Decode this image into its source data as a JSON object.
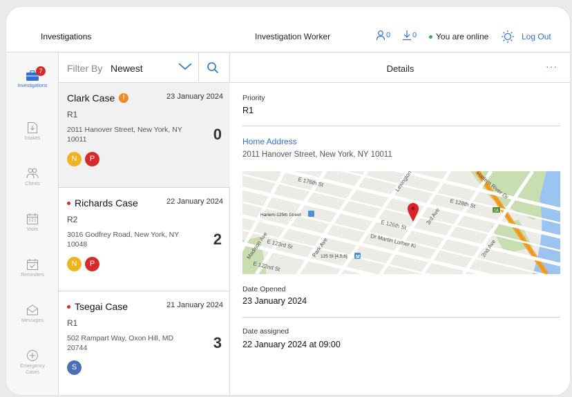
{
  "header": {
    "title": "Investigations",
    "role": "Investigation Worker",
    "clients_count": "0",
    "downloads_count": "0",
    "status_text": "You are online",
    "logout_label": "Log Out"
  },
  "sidebar": {
    "investigations_badge": "7",
    "items": [
      {
        "label": "Investigations",
        "icon": "briefcase-icon"
      },
      {
        "label": "Intakes",
        "icon": "intake-icon"
      },
      {
        "label": "Clients",
        "icon": "clients-icon"
      },
      {
        "label": "Visits",
        "icon": "calendar-icon"
      },
      {
        "label": "Reminders",
        "icon": "calendar-check-icon"
      },
      {
        "label": "Messages",
        "icon": "envelope-icon"
      },
      {
        "label": "Emergency Cases",
        "icon": "plus-circle-icon"
      }
    ]
  },
  "filter": {
    "label": "Filter By",
    "value": "Newest"
  },
  "cases": [
    {
      "name": "Clark Case",
      "date": "23 January 2024",
      "priority": "R1",
      "address": "2011 Hanover Street, New York, NY 10011",
      "count": "0",
      "avatars": [
        {
          "letter": "N",
          "color": "#f2b21e"
        },
        {
          "letter": "P",
          "color": "#d62b2b"
        }
      ]
    },
    {
      "name": "Richards Case",
      "date": "22 January 2024",
      "priority": "R2",
      "address": "3016 Godfrey Road, New York, NY 10048",
      "count": "2",
      "avatars": [
        {
          "letter": "N",
          "color": "#f2b21e"
        },
        {
          "letter": "P",
          "color": "#d62b2b"
        }
      ]
    },
    {
      "name": "Tsegai Case",
      "date": "21 January 2024",
      "priority": "R1",
      "address": "502 Rampart Way, Oxon Hill, MD 20744",
      "count": "3",
      "avatars": [
        {
          "letter": "S",
          "color": "#4a6fb5"
        }
      ]
    }
  ],
  "details": {
    "title": "Details",
    "more": "···",
    "priority_label": "Priority",
    "priority_value": "R1",
    "home_address_label": "Home Address",
    "home_address_value": "2011 Hanover Street, New York, NY 10011",
    "date_opened_label": "Date Opened",
    "date_opened_value": "23 January 2024",
    "date_assigned_label": "Date assigned",
    "date_assigned_value": "22 January 2024 at 09:00",
    "map_labels": {
      "st176": "E 176th St",
      "lexington": "Lexington",
      "harlem": "Harlem-125th Street",
      "st126": "E 126th St",
      "third_ave": "3rd Ave",
      "st128": "E 128th St",
      "madison": "Madison Ave",
      "park": "Park Ave",
      "station": "125 St [4,5,6]",
      "mlk": "Dr Martin Luther Ki",
      "st123": "E 123rd St",
      "st122": "E 122nd St",
      "second_ave": "2nd Ave",
      "harlem_river": "Harlem River Dr",
      "route_shield": "1A"
    }
  }
}
